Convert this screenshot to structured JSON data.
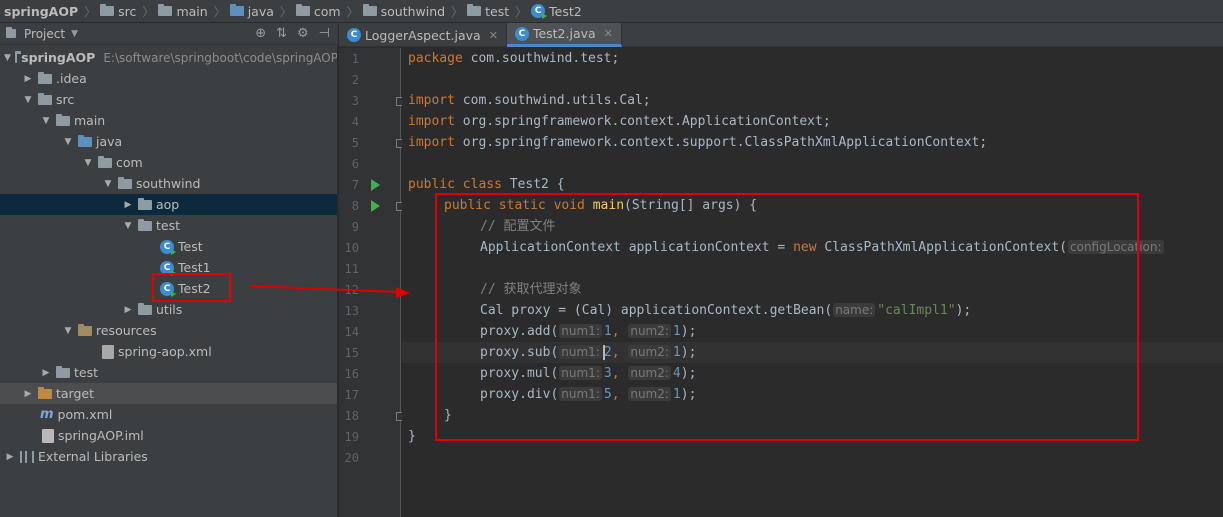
{
  "breadcrumb": [
    "springAOP",
    "src",
    "main",
    "java",
    "com",
    "southwind",
    "test",
    "Test2"
  ],
  "project_panel": {
    "title": "Project",
    "tree": [
      {
        "label": "springAOP",
        "path": "E:\\software\\springboot\\code\\springAOP"
      },
      {
        "label": ".idea"
      },
      {
        "label": "src"
      },
      {
        "label": "main"
      },
      {
        "label": "java"
      },
      {
        "label": "com"
      },
      {
        "label": "southwind"
      },
      {
        "label": "aop"
      },
      {
        "label": "test"
      },
      {
        "label": "Test"
      },
      {
        "label": "Test1"
      },
      {
        "label": "Test2"
      },
      {
        "label": "utils"
      },
      {
        "label": "resources"
      },
      {
        "label": "spring-aop.xml"
      },
      {
        "label": "test"
      },
      {
        "label": "target"
      },
      {
        "label": "pom.xml"
      },
      {
        "label": "springAOP.iml"
      },
      {
        "label": "External Libraries"
      }
    ]
  },
  "tabs": [
    {
      "label": "LoggerAspect.java",
      "active": false
    },
    {
      "label": "Test2.java",
      "active": true
    }
  ],
  "editor": {
    "line_numbers": [
      "1",
      "2",
      "3",
      "4",
      "5",
      "6",
      "7",
      "8",
      "9",
      "10",
      "11",
      "12",
      "13",
      "14",
      "15",
      "16",
      "17",
      "18",
      "19",
      "20"
    ],
    "code": {
      "l1_kw": "package",
      "l1_rest": " com.southwind.test;",
      "l3_kw": "import",
      "l3_rest": " com.southwind.utils.Cal;",
      "l4_kw": "import",
      "l4_rest": " org.springframework.context.ApplicationContext;",
      "l5_kw": "import",
      "l5_rest": " org.springframework.context.support.ClassPathXmlApplicationContext;",
      "l7_kw": "public class",
      "l7_rest": " Test2 {",
      "l8_kw": "public static void",
      "l8_fn": "main",
      "l8_rest": "(String[] args) {",
      "l9_cm": "// 配置文件",
      "l10_a": "ApplicationContext applicationContext = ",
      "l10_kw": "new",
      "l10_b": " ClassPathXmlApplicationContext(",
      "l10_hint": "configLocation:",
      "l12_cm": "// 获取代理对象",
      "l13_a": "Cal proxy = (Cal) applicationContext.getBean(",
      "l13_hint": "name:",
      "l13_str": "\"calImpl1\"",
      "l13_b": ");",
      "l14_a": "proxy.add(",
      "l15_a": "proxy.sub(",
      "l16_a": "proxy.mul(",
      "l17_a": "proxy.div(",
      "hint_num1": "num1:",
      "hint_num2": "num2:",
      "l14_v1": "1",
      "l14_v2": "1",
      "l15_v1": "2",
      "l15_v2": "1",
      "l16_v1": "3",
      "l16_v2": "4",
      "l17_v1": "5",
      "l17_v2": "1",
      "comma": ",",
      "close": ");",
      "l18": "}",
      "l19": "}"
    }
  },
  "colors": {
    "keyword": "#cc7832",
    "string": "#6a8759",
    "comment": "#808080",
    "function": "#ffc66d",
    "annotation_red": "#e00000"
  }
}
